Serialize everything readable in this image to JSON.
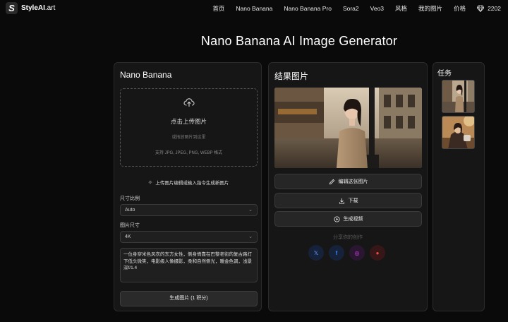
{
  "nav": {
    "logo_mark": "S",
    "logo_name": "StyleAI",
    "logo_suffix": ".art",
    "items": [
      "首页",
      "Nano Banana",
      "Nano Banana Pro",
      "Sora2",
      "Veo3",
      "风格",
      "我的图片",
      "价格"
    ],
    "credits": "2202"
  },
  "page_title": "Nano Banana AI Image Generator",
  "left_panel": {
    "title": "Nano Banana",
    "upload": {
      "main": "点击上传图片",
      "sub": "或拖放图片到这里",
      "formats": "支持 JPG, JPEG, PNG, WEBP 格式"
    },
    "hint": "上传图片编辑或输入指令生成新图片",
    "aspect_label": "尺寸比例",
    "aspect_value": "Auto",
    "size_label": "图片尺寸",
    "size_value": "4K",
    "prompt": "一位身穿米色风衣的东方女性，侧身倚靠在巴黎老街的复古路灯下低头微笑，电影级人像摄影，柔和自然侧光，暖金色调，浅景深f/1.4",
    "generate": "生成图片 (1 积分)"
  },
  "mid_panel": {
    "title": "结果图片",
    "edit": "编辑这张图片",
    "download": "下载",
    "video": "生成视频",
    "share": "分享你的创作",
    "social_x": "𝕏",
    "social_fb": "f",
    "social_ig": "◎",
    "social_rd": "●"
  },
  "right_panel": {
    "title": "任务"
  },
  "colors": {
    "background": "#0a0a0a",
    "panel": "#161616",
    "border": "#2b2b2b"
  }
}
